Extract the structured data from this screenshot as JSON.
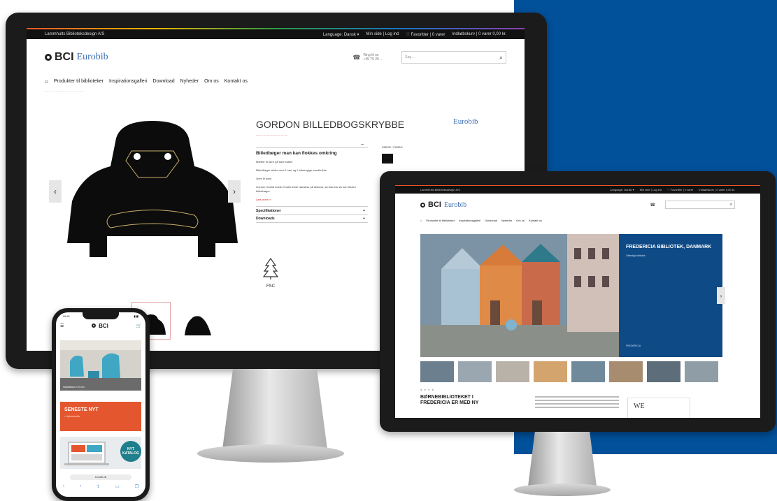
{
  "colors": {
    "blue_panel": "#00509a",
    "accent_red": "#cc3333",
    "orange": "#e4572e",
    "hero_blue": "#0d4a86",
    "eurobib_blue": "#3d6fb0"
  },
  "desktop": {
    "topbar": {
      "company": "Lammhults Biblioteksdesign A/S",
      "language": "Language: Dansk ▾",
      "account": "Min side | Log ind",
      "favorites": "♡ Favoritter | 0 varer",
      "cart": "Indkøbskurv | 0 varer 0,00 kr."
    },
    "header": {
      "logo_bci": "BCI",
      "logo_eurobib": "Eurobib",
      "phone_label": "Ring til os",
      "phone_number": "+45 70 20 ..",
      "search_placeholder": "Søg ..."
    },
    "nav": [
      "Produkter til biblioteker",
      "Inspirationsgalleri",
      "Download",
      "Nyheder",
      "Om os",
      "Kontakt os"
    ],
    "product": {
      "title": "GORDON BILLEDBOGSKRYBBE",
      "brand": "Eurobib",
      "colors_label": "FARVE / FINISH",
      "desc_heading": "Billedbøger man kan flokkes omkring",
      "desc_lines": [
        "Mætter til børn på bare sidde!",
        "Billedbøger ældre med 1 sæt og 2 afhængige sandbrikke.",
        "3mm til børn.",
        "Gordon Gorilla holder fersteriende dansksk på afstand, så barnets sin kan tilsdri i billedbøger."
      ],
      "read_more": "Læs mere »",
      "accordion": [
        "Specifikationer",
        "Downloads"
      ],
      "fsc_label": "FSC"
    }
  },
  "tablet": {
    "topbar": {
      "company": "Lammhults Biblioteksdesign A/S",
      "language": "Language: Dansk ▾",
      "account": "Min side | Log ind",
      "favorites": "♡ Favoritter | 0 varer",
      "cart": "Indkøbskurv | 0 varer 0,00 kr."
    },
    "logo_bci": "BCI",
    "logo_eurobib": "Eurobib",
    "nav": [
      "Produkter til biblioteker",
      "Inspirationsgalleri",
      "Download",
      "Nyheder",
      "Om os",
      "Kontakt os"
    ],
    "hero": {
      "title": "FREDERICIA BIBLIOTEK, DANMARK",
      "subtitle": "Offentligt bibliotek",
      "footer": "FREDERICIA"
    },
    "article_title": "BØRNEBIBLIOTEKET I FREDERICIA ER MED NY",
    "side_text": "WE"
  },
  "phone": {
    "time": "09:41",
    "logo_bci": "BCI",
    "hero_caption": "Inspirations i et rum",
    "news_title": "SENESTE NYT",
    "news_sub": "> Nyhedsarkiv",
    "badge": "NYT KATALOG",
    "url": "eurobib.dk"
  }
}
